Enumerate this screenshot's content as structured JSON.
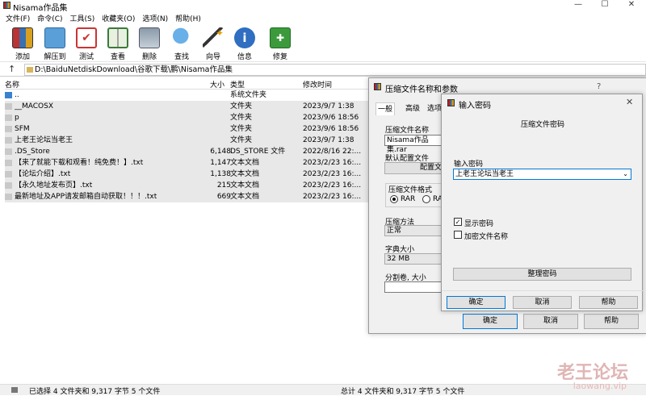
{
  "window": {
    "title": "Nisama作品集",
    "min": "—",
    "max": "☐",
    "close": "✕"
  },
  "menu": [
    "文件(F)",
    "命令(C)",
    "工具(S)",
    "收藏夹(O)",
    "选项(N)",
    "帮助(H)"
  ],
  "toolbar": {
    "add": "添加",
    "extract": "解压到",
    "test": "测试",
    "view": "查看",
    "delete": "删除",
    "find": "查找",
    "wizard": "向导",
    "info": "信息",
    "repair": "修复"
  },
  "address": {
    "path": "D:\\BaiduNetdiskDownload\\谷歌下载\\鹏\\Nisama作品集",
    "up": "↑"
  },
  "list": {
    "headers": {
      "name": "名称",
      "size": "大小",
      "type": "类型",
      "modified": "修改时间"
    },
    "rows": [
      {
        "name": "..",
        "size": "",
        "type": "系统文件夹",
        "date": ""
      },
      {
        "name": "__MACOSX",
        "size": "",
        "type": "文件夹",
        "date": "2023/9/7 1:38"
      },
      {
        "name": "p",
        "size": "",
        "type": "文件夹",
        "date": "2023/9/6 18:56"
      },
      {
        "name": "SFM",
        "size": "",
        "type": "文件夹",
        "date": "2023/9/6 18:56"
      },
      {
        "name": "上老王论坛当老王",
        "size": "",
        "type": "文件夹",
        "date": "2023/9/7 1:38"
      },
      {
        "name": ".DS_Store",
        "size": "6,148",
        "type": "DS_STORE 文件",
        "date": "2022/8/16 22:..."
      },
      {
        "name": "【来了就能下载和观看！纯免费！】.txt",
        "size": "1,147",
        "type": "文本文档",
        "date": "2023/2/23 16:..."
      },
      {
        "name": "【论坛介绍】.txt",
        "size": "1,138",
        "type": "文本文档",
        "date": "2023/2/23 16:..."
      },
      {
        "name": "【永久地址发布页】.txt",
        "size": "215",
        "type": "文本文档",
        "date": "2023/2/23 16:..."
      },
      {
        "name": "最新地址及APP请发邮箱自动获取！！！.txt",
        "size": "669",
        "type": "文本文档",
        "date": "2023/2/23 16:..."
      }
    ]
  },
  "status": {
    "left": "已选择 4 文件夹和 9,317 字节 5 个文件",
    "right": "总计 4 文件夹和 9,317 字节 5 个文件"
  },
  "archive_dialog": {
    "title": "压缩文件名称和参数",
    "help": "?",
    "tabs": [
      "一般",
      "高级",
      "选项"
    ],
    "name_label": "压缩文件名称",
    "name_value": "Nisama作品集.rar",
    "profile_label": "默认配置文件",
    "profile_button": "配置文",
    "format_label": "压缩文件格式",
    "format_rar": "RAR",
    "format_rar4": "RAR",
    "method_label": "压缩方法",
    "method_value": "正常",
    "dict_label": "字典大小",
    "dict_value": "32 MB",
    "split_label": "分割卷, 大小",
    "ok": "确定",
    "cancel": "取消",
    "help_btn": "帮助"
  },
  "password_dialog": {
    "title": "输入密码",
    "close": "✕",
    "heading": "压缩文件密码",
    "enter_label": "输入密码",
    "password_value": "上老王论坛当老王",
    "show_password": "显示密码",
    "show_checked": "✓",
    "encrypt_names": "加密文件名称",
    "organize": "整理密码",
    "ok": "确定",
    "cancel": "取消",
    "help": "帮助"
  },
  "watermark": {
    "line1": "老王论坛",
    "line2": "laowang.vip"
  }
}
